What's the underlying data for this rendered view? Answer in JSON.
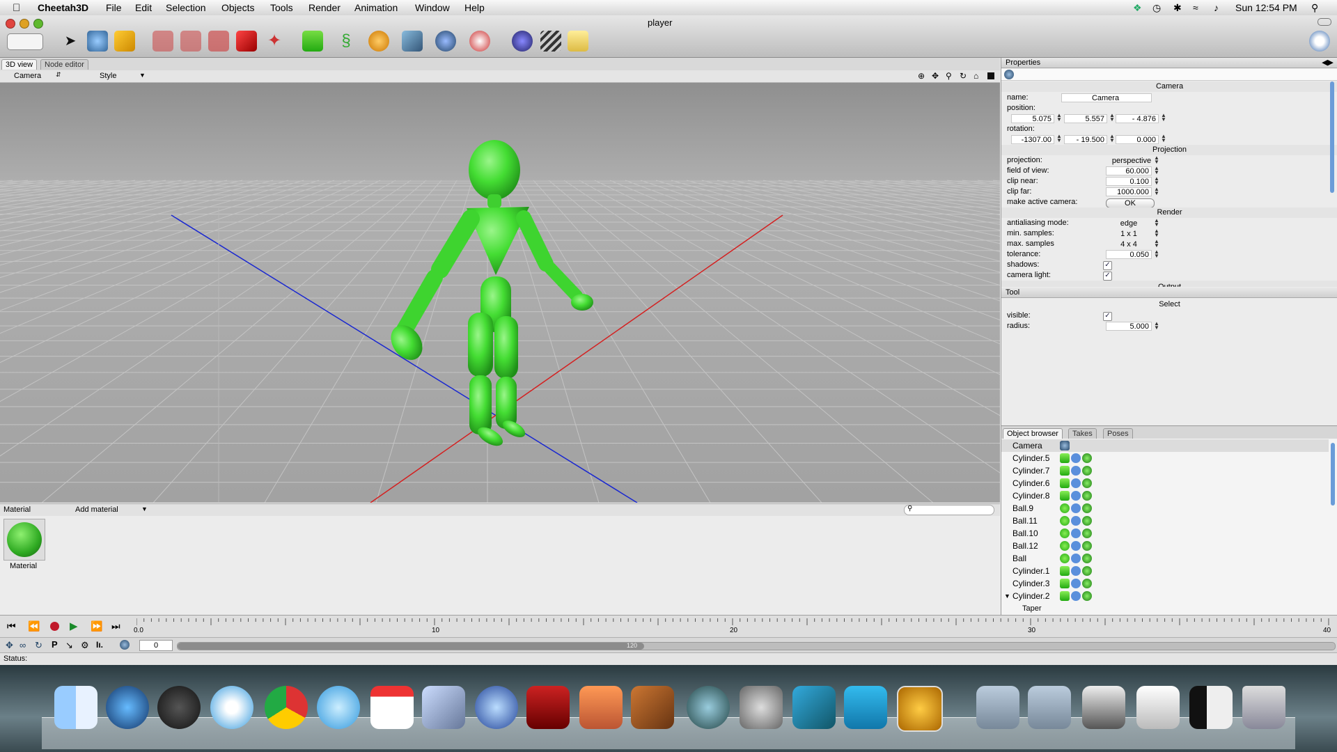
{
  "menubar": {
    "app_name": "Cheetah3D",
    "items": [
      "File",
      "Edit",
      "Selection",
      "Objects",
      "Tools",
      "Render",
      "Animation",
      "Window",
      "Help"
    ],
    "clock": "Sun 12:54 PM"
  },
  "window": {
    "title": "player"
  },
  "viewport": {
    "tabs": [
      "3D view",
      "Node editor"
    ],
    "camera_menu": "Camera",
    "style_menu": "Style"
  },
  "material": {
    "header_label": "Material",
    "add_label": "Add material",
    "items": [
      {
        "name": "Material",
        "color": "#3fbf3f"
      }
    ]
  },
  "properties": {
    "header": "Properties",
    "camera_section": "Camera",
    "name_label": "name:",
    "name_value": "Camera",
    "position_label": "position:",
    "position": [
      "5.075",
      "5.557",
      "- 4.876"
    ],
    "rotation_label": "rotation:",
    "rotation": [
      "-1307.00",
      "- 19.500",
      "0.000"
    ],
    "projection_section": "Projection",
    "projection_label": "projection:",
    "projection_value": "perspective",
    "fov_label": "field of view:",
    "fov_value": "60.000",
    "clip_near_label": "clip near:",
    "clip_near_value": "0.100",
    "clip_far_label": "clip far:",
    "clip_far_value": "1000.000",
    "make_active_label": "make active camera:",
    "ok_label": "OK",
    "render_section": "Render",
    "aa_label": "antialiasing mode:",
    "aa_value": "edge",
    "min_samples_label": "min. samples:",
    "min_samples_value": "1 x 1",
    "max_samples_label": "max. samples",
    "max_samples_value": "4 x 4",
    "tolerance_label": "tolerance:",
    "tolerance_value": "0.050",
    "shadows_label": "shadows:",
    "camera_light_label": "camera light:",
    "output_section": "Output"
  },
  "tool": {
    "header": "Tool",
    "section": "Select",
    "visible_label": "visible:",
    "radius_label": "radius:",
    "radius_value": "5.000"
  },
  "object_browser": {
    "tabs": [
      "Object browser",
      "Takes",
      "Poses"
    ],
    "items": [
      "Camera",
      "Cylinder.5",
      "Cylinder.7",
      "Cylinder.6",
      "Cylinder.8",
      "Ball.9",
      "Ball.11",
      "Ball.10",
      "Ball.12",
      "Ball",
      "Cylinder.1",
      "Cylinder.3",
      "Cylinder.2"
    ],
    "partial_item": "Taper"
  },
  "timeline": {
    "ticks": [
      "0.0",
      "10",
      "20",
      "30",
      "40"
    ],
    "frame_value": "0",
    "range_label": "120"
  },
  "status": {
    "label": "Status:"
  },
  "colors": {
    "figure": "#44dd33",
    "x_axis": "#d02020",
    "z_axis": "#2030d0",
    "viewport_bg": "#9c9c9c"
  }
}
